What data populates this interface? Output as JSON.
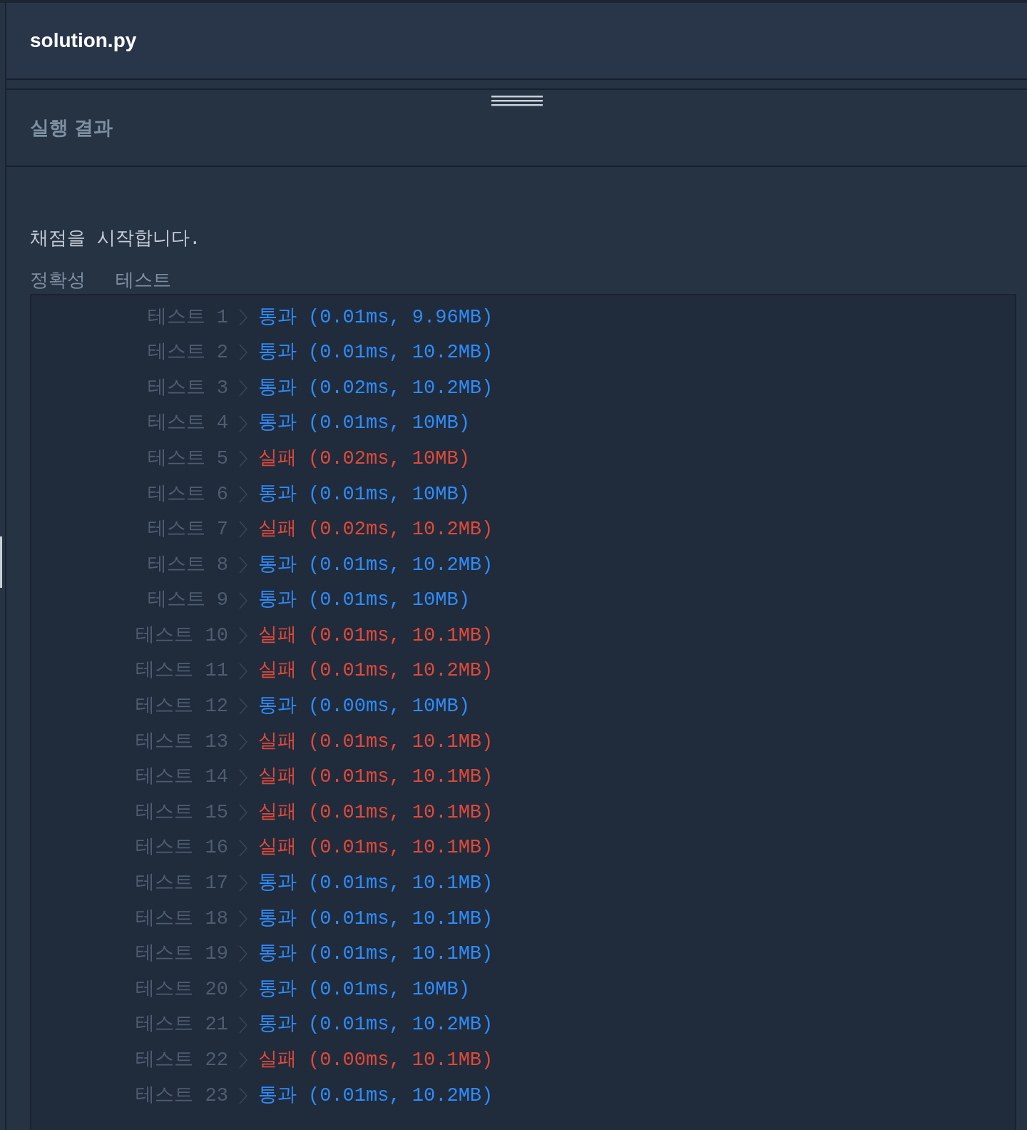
{
  "editor": {
    "filename": "solution.py"
  },
  "results_panel": {
    "title": "실행 결과",
    "intro": "채점을 시작합니다.",
    "section_title": "정확성  테스트",
    "tests": [
      {
        "label": "테스트 1",
        "kind": "pass",
        "status": "통과",
        "detail": "(0.01ms, 9.96MB)"
      },
      {
        "label": "테스트 2",
        "kind": "pass",
        "status": "통과",
        "detail": "(0.01ms, 10.2MB)"
      },
      {
        "label": "테스트 3",
        "kind": "pass",
        "status": "통과",
        "detail": "(0.02ms, 10.2MB)"
      },
      {
        "label": "테스트 4",
        "kind": "pass",
        "status": "통과",
        "detail": "(0.01ms, 10MB)"
      },
      {
        "label": "테스트 5",
        "kind": "fail",
        "status": "실패",
        "detail": "(0.02ms, 10MB)"
      },
      {
        "label": "테스트 6",
        "kind": "pass",
        "status": "통과",
        "detail": "(0.01ms, 10MB)"
      },
      {
        "label": "테스트 7",
        "kind": "fail",
        "status": "실패",
        "detail": "(0.02ms, 10.2MB)"
      },
      {
        "label": "테스트 8",
        "kind": "pass",
        "status": "통과",
        "detail": "(0.01ms, 10.2MB)"
      },
      {
        "label": "테스트 9",
        "kind": "pass",
        "status": "통과",
        "detail": "(0.01ms, 10MB)"
      },
      {
        "label": "테스트 10",
        "kind": "fail",
        "status": "실패",
        "detail": "(0.01ms, 10.1MB)"
      },
      {
        "label": "테스트 11",
        "kind": "fail",
        "status": "실패",
        "detail": "(0.01ms, 10.2MB)"
      },
      {
        "label": "테스트 12",
        "kind": "pass",
        "status": "통과",
        "detail": "(0.00ms, 10MB)"
      },
      {
        "label": "테스트 13",
        "kind": "fail",
        "status": "실패",
        "detail": "(0.01ms, 10.1MB)"
      },
      {
        "label": "테스트 14",
        "kind": "fail",
        "status": "실패",
        "detail": "(0.01ms, 10.1MB)"
      },
      {
        "label": "테스트 15",
        "kind": "fail",
        "status": "실패",
        "detail": "(0.01ms, 10.1MB)"
      },
      {
        "label": "테스트 16",
        "kind": "fail",
        "status": "실패",
        "detail": "(0.01ms, 10.1MB)"
      },
      {
        "label": "테스트 17",
        "kind": "pass",
        "status": "통과",
        "detail": "(0.01ms, 10.1MB)"
      },
      {
        "label": "테스트 18",
        "kind": "pass",
        "status": "통과",
        "detail": "(0.01ms, 10.1MB)"
      },
      {
        "label": "테스트 19",
        "kind": "pass",
        "status": "통과",
        "detail": "(0.01ms, 10.1MB)"
      },
      {
        "label": "테스트 20",
        "kind": "pass",
        "status": "통과",
        "detail": "(0.01ms, 10MB)"
      },
      {
        "label": "테스트 21",
        "kind": "pass",
        "status": "통과",
        "detail": "(0.01ms, 10.2MB)"
      },
      {
        "label": "테스트 22",
        "kind": "fail",
        "status": "실패",
        "detail": "(0.00ms, 10.1MB)"
      },
      {
        "label": "테스트 23",
        "kind": "pass",
        "status": "통과",
        "detail": "(0.01ms, 10.2MB)"
      }
    ]
  }
}
